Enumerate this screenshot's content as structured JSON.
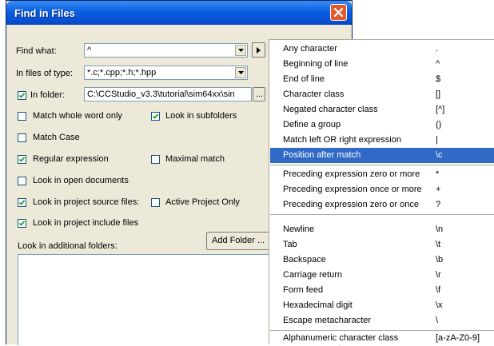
{
  "dialog": {
    "title": "Find in Files",
    "find_what_label": "Find what:",
    "find_what_value": "^",
    "file_types_label": "In files of type:",
    "file_types_value": "*.c;*.cpp;*.h;*.hpp",
    "in_folder_label": "In folder:",
    "in_folder_value": "C:\\CCStudio_v3.3\\tutorial\\sim64xx\\sin",
    "browse_label": "...",
    "add_folder_label": "Add Folder ...",
    "additional_folders_label": "Look in additional folders:",
    "options": {
      "in_folder": true,
      "match_whole_word": {
        "label": "Match whole word only",
        "checked": false
      },
      "look_in_subfolders": {
        "label": "Look in subfolders",
        "checked": true
      },
      "match_case": {
        "label": "Match Case",
        "checked": false
      },
      "regular_expression": {
        "label": "Regular expression",
        "checked": true
      },
      "maximal_match": {
        "label": "Maximal match",
        "checked": false
      },
      "look_in_open_documents": {
        "label": "Look in open documents",
        "checked": false
      },
      "look_in_project_source": {
        "label": "Look in project source files:",
        "checked": true
      },
      "active_project_only": {
        "label": "Active Project Only",
        "checked": false
      },
      "look_in_project_include": {
        "label": "Look in project include files",
        "checked": true
      }
    }
  },
  "regex_menu": {
    "selected_item": "Position after match",
    "items": [
      {
        "label": "Any character",
        "symbol": "."
      },
      {
        "label": "Beginning of line",
        "symbol": "^"
      },
      {
        "label": "End of line",
        "symbol": "$"
      },
      {
        "label": "Character class",
        "symbol": "[]"
      },
      {
        "label": "Negated character class",
        "symbol": "[^]"
      },
      {
        "label": "Define a group",
        "symbol": "()"
      },
      {
        "label": "Match left OR right expression",
        "symbol": "|"
      },
      {
        "label": "Position after match",
        "symbol": "\\c"
      },
      {
        "label": "Preceding expression zero or more",
        "symbol": "*"
      },
      {
        "label": "Preceding expression once or more",
        "symbol": "+"
      },
      {
        "label": "Preceding expression zero or once",
        "symbol": "?"
      },
      {
        "label": "Newline",
        "symbol": "\\n"
      },
      {
        "label": "Tab",
        "symbol": "\\t"
      },
      {
        "label": "Backspace",
        "symbol": "\\b"
      },
      {
        "label": "Carriage return",
        "symbol": "\\r"
      },
      {
        "label": "Form feed",
        "symbol": "\\f"
      },
      {
        "label": "Hexadecimal digit",
        "symbol": "\\x"
      },
      {
        "label": "Escape metacharacter",
        "symbol": "\\"
      },
      {
        "label": "Alphanumeric character class",
        "symbol": "[a-zA-Z0-9]"
      }
    ]
  }
}
